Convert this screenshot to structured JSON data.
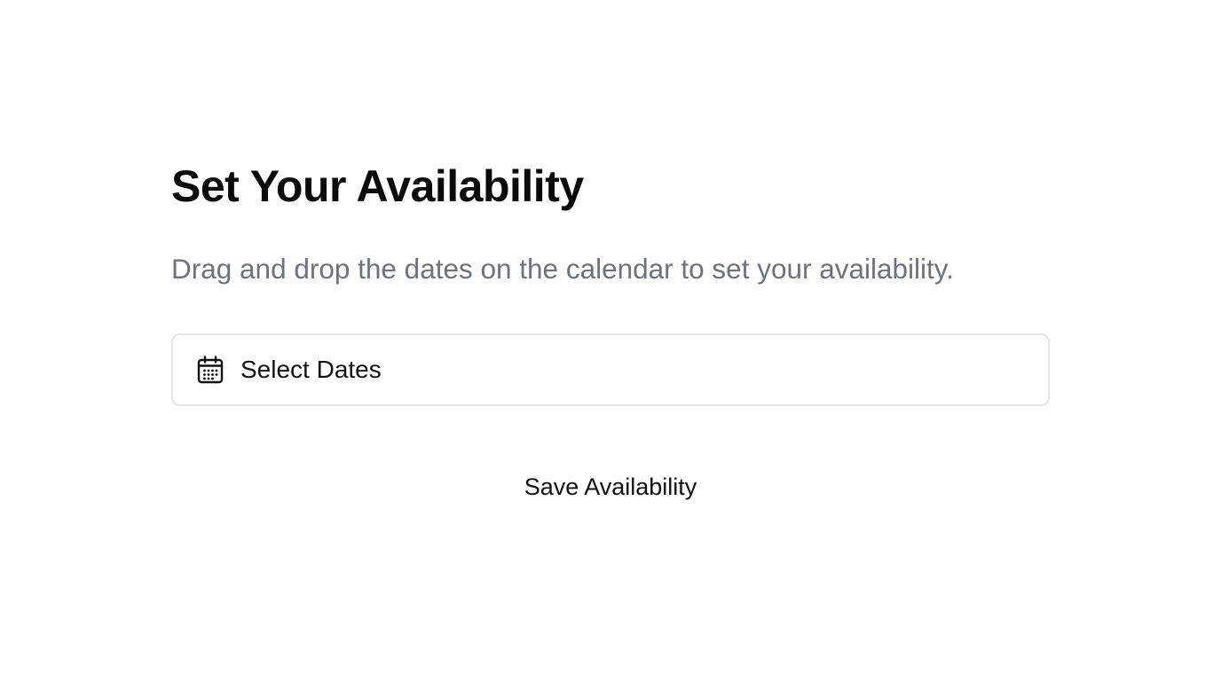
{
  "header": {
    "title": "Set Your Availability",
    "subtitle": "Drag and drop the dates on the calendar to set your availability."
  },
  "date_picker": {
    "icon": "calendar-icon",
    "label": "Select Dates"
  },
  "actions": {
    "save_label": "Save Availability"
  },
  "colors": {
    "subtitle_text": "#6b7280",
    "input_border": "#e5e5e5",
    "text": "#111111"
  }
}
